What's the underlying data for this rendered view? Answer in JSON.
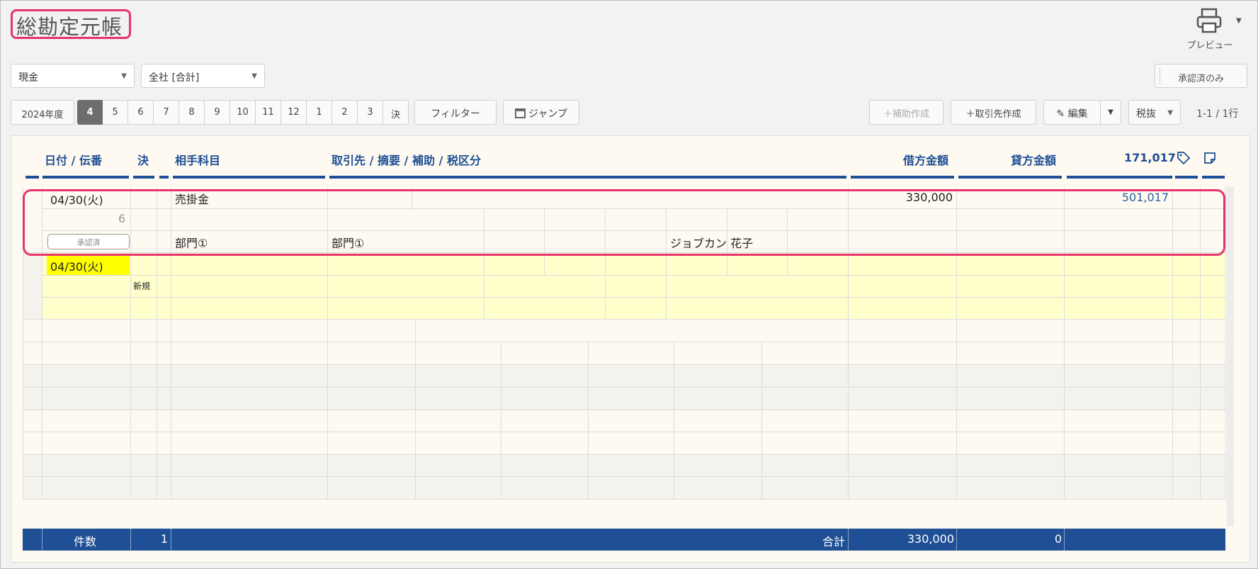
{
  "title": "総勘定元帳",
  "toolbar": {
    "preview_label": "プレビュー",
    "account_select": "現金",
    "dept_select": "全社 [合計]",
    "approved_only": "承認済のみ"
  },
  "tabs": {
    "year": "2024年度",
    "months": [
      "4",
      "5",
      "6",
      "7",
      "8",
      "9",
      "10",
      "11",
      "12",
      "1",
      "2",
      "3",
      "決"
    ],
    "active": "4"
  },
  "actions": {
    "filter": "フィルター",
    "jump": "ジャンプ",
    "sub_create": "補助作成",
    "partner_create": "取引先作成",
    "edit": "編集",
    "tax": "税抜",
    "paging": "1-1 / 1行"
  },
  "columns": {
    "date": "日付 / 伝番",
    "settle": "決",
    "counter_account": "相手科目",
    "partner": "取引先 / 摘要 / 補助 / 税区分",
    "debit": "借方金額",
    "credit": "貸方金額",
    "balance": "171,017"
  },
  "entry": {
    "date": "04/30(火)",
    "number": "6",
    "status": "承認済",
    "counter_account": "売掛金",
    "counter_dept": "部門①",
    "partner_dept": "部門①",
    "person": "ジョブカン 花子",
    "debit": "330,000",
    "balance": "501,017"
  },
  "new_row": {
    "date": "04/30(火)",
    "label": "新規"
  },
  "footer": {
    "count_label": "件数",
    "count": "1",
    "total_label": "合計",
    "debit_total": "330,000",
    "credit_total": "0"
  }
}
